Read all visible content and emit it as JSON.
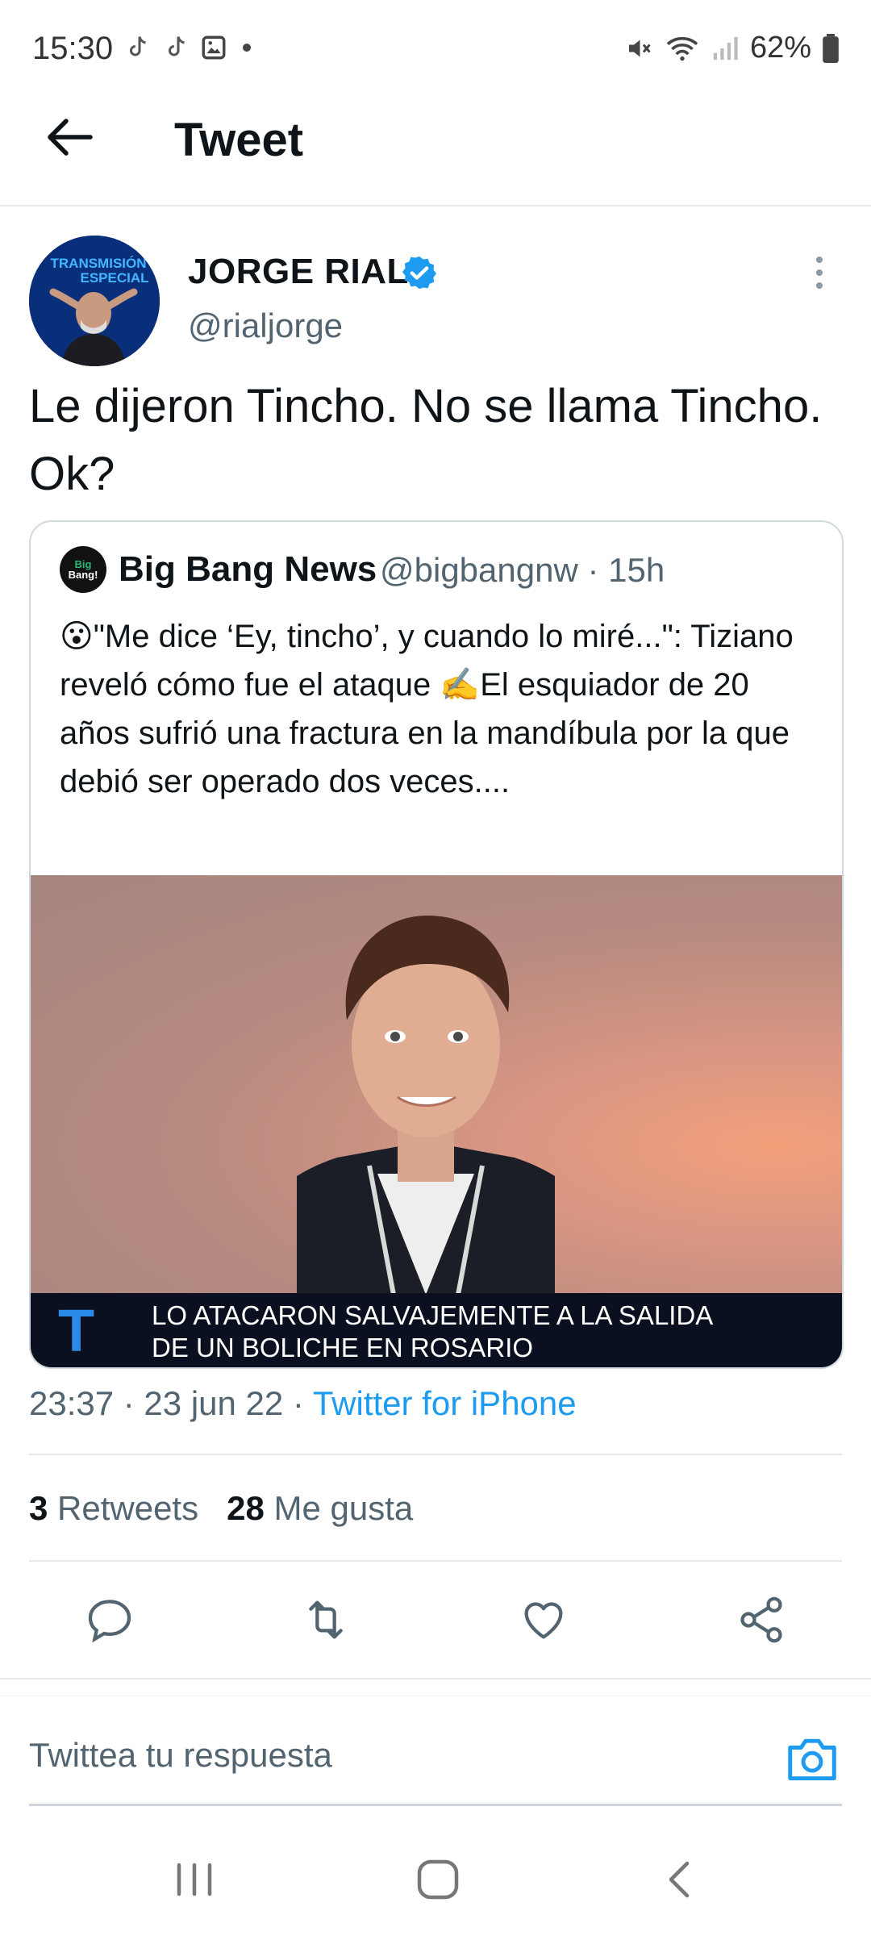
{
  "status_bar": {
    "time": "15:30",
    "battery": "62%"
  },
  "header": {
    "title": "Tweet"
  },
  "tweet": {
    "author_name": "JORGE RIAL",
    "handle": "@rialjorge",
    "text": "Le dijeron Tincho. No se llama Tincho. Ok?",
    "avatar_text": "TRANSMISIÓN ESPECIAL",
    "timestamp": "23:37 · 23 jun 22 · ",
    "source": "Twitter for iPhone",
    "retweets_count": "3",
    "retweets_label": " Retweets",
    "likes_count": "28",
    "likes_label": " Me gusta"
  },
  "quote": {
    "avatar_line1": "Big",
    "avatar_line2": "Bang!",
    "name": "Big Bang News",
    "handle_time": "@bigbangnw · 15h",
    "text": "😮\"Me dice ‘Ey, tincho’, y cuando lo miré...\": Tiziano reveló cómo fue el ataque ✍️El esquiador de 20 años sufrió una fractura en la mandíbula por la que debió ser operado dos veces....",
    "banner_line1": "LO ATACARON SALVAJEMENTE A LA SALIDA",
    "banner_line2": "DE UN BOLICHE EN ROSARIO",
    "banner_logo": "T"
  },
  "reply": {
    "placeholder": "Twittea tu respuesta"
  },
  "colors": {
    "accent": "#1d9bf0",
    "text": "#0f1419",
    "muted": "#536471"
  },
  "icons": [
    "back-arrow-icon",
    "verified-icon",
    "more-icon",
    "reply-icon",
    "retweet-icon",
    "like-icon",
    "share-icon",
    "camera-icon"
  ]
}
